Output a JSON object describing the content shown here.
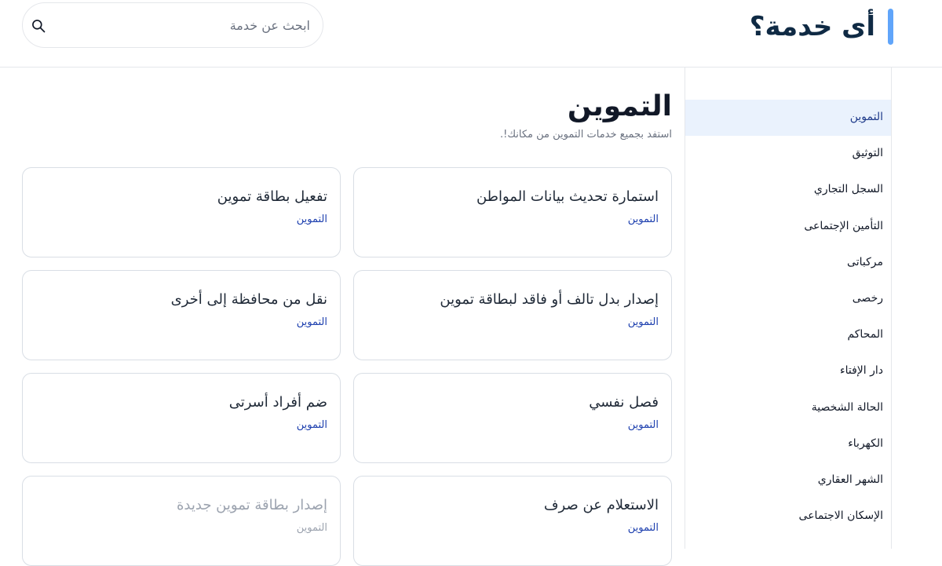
{
  "header": {
    "brand_title": "أى خدمة؟",
    "search_placeholder": "ابحث عن خدمة",
    "search_value": ""
  },
  "sidebar": {
    "items": [
      {
        "label": "التموين",
        "active": true
      },
      {
        "label": "التوثيق"
      },
      {
        "label": "السجل التجاري"
      },
      {
        "label": "التأمين الإجتماعى"
      },
      {
        "label": "مركباتى"
      },
      {
        "label": "رخصى"
      },
      {
        "label": "المحاكم"
      },
      {
        "label": "دار الإفتاء"
      },
      {
        "label": "الحالة الشخصية"
      },
      {
        "label": "الكهرباء"
      },
      {
        "label": "الشهر العقاري"
      },
      {
        "label": "الإسكان الاجتماعى"
      }
    ]
  },
  "main": {
    "title": "التموين",
    "subtitle": "استفد بجميع خدمات التموين من مكانك!.",
    "cards": [
      {
        "title": "استمارة تحديث بيانات المواطن",
        "category": "التموين"
      },
      {
        "title": "تفعيل بطاقة تموين",
        "category": "التموين"
      },
      {
        "title": "إصدار بدل تالف أو فاقد لبطاقة تموين",
        "category": "التموين"
      },
      {
        "title": "نقل من محافظة إلى أخرى",
        "category": "التموين"
      },
      {
        "title": "فصل نفسي",
        "category": "التموين"
      },
      {
        "title": "ضم أفراد أسرتى",
        "category": "التموين"
      },
      {
        "title": "الاستعلام عن صرف",
        "category": "التموين"
      },
      {
        "title": "إصدار بطاقة تموين جديدة",
        "category": "التموين",
        "disabled": true
      }
    ]
  },
  "colors": {
    "accent": "#60a5fa",
    "brand_text": "#0f2a44",
    "active_bg": "#eaf2fd",
    "category_text": "#1e40af"
  }
}
